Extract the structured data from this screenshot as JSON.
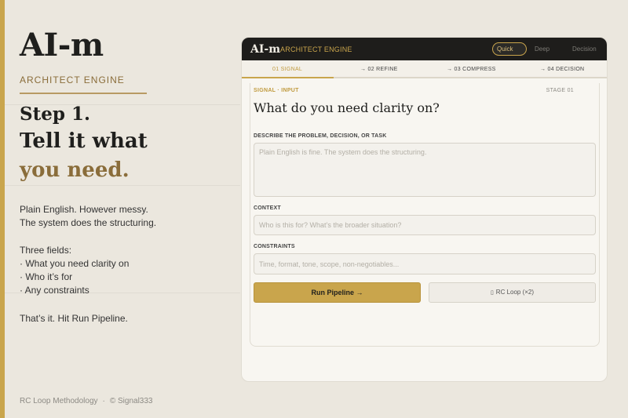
{
  "sidebar": {
    "brand": "AI-m",
    "brand_sub": "ARCHITECT  ENGINE",
    "step_label": "Step 1.",
    "headline_1": "Tell it what",
    "headline_2": "you need.",
    "intro_line_1": "Plain English. However messy.",
    "intro_line_2": "The system does the structuring.",
    "fields_heading": "Three fields:",
    "fields": [
      "· What you need clarity on",
      "· Who it’s for",
      "· Any constraints"
    ],
    "closing": "That’s it. Hit Run Pipeline.",
    "footer_left": "RC Loop Methodology",
    "footer_sep": "·",
    "footer_right": "© Signal333",
    "accent_color": "#c9a54c"
  },
  "app": {
    "logo": "AI-m",
    "logo_sub": "ARCHITECT ENGINE",
    "modes": {
      "quick": "Quick",
      "deep": "Deep",
      "decision": "Decision",
      "selected": "Quick"
    },
    "stages": [
      {
        "label": "01  SIGNAL"
      },
      {
        "label": "→  02  REFINE"
      },
      {
        "label": "→  03  COMPRESS"
      },
      {
        "label": "→  04  DECISION"
      }
    ],
    "eyebrow": "SIGNAL · INPUT",
    "stage_num": "STAGE 01",
    "title": "What do you need clarity on?",
    "problem_label": "DESCRIBE THE PROBLEM, DECISION, OR TASK",
    "problem_placeholder": "Plain English is fine. The system does the structuring.",
    "context_label": "CONTEXT",
    "context_placeholder": "Who is this for? What’s the broader situation?",
    "constraints_label": "CONSTRAINTS",
    "constraints_placeholder": "Time, format, tone, scope, non-negotiables...",
    "run_button": "Run Pipeline →",
    "loop_icon": "▯",
    "loop_button": "RC Loop (×2)"
  }
}
